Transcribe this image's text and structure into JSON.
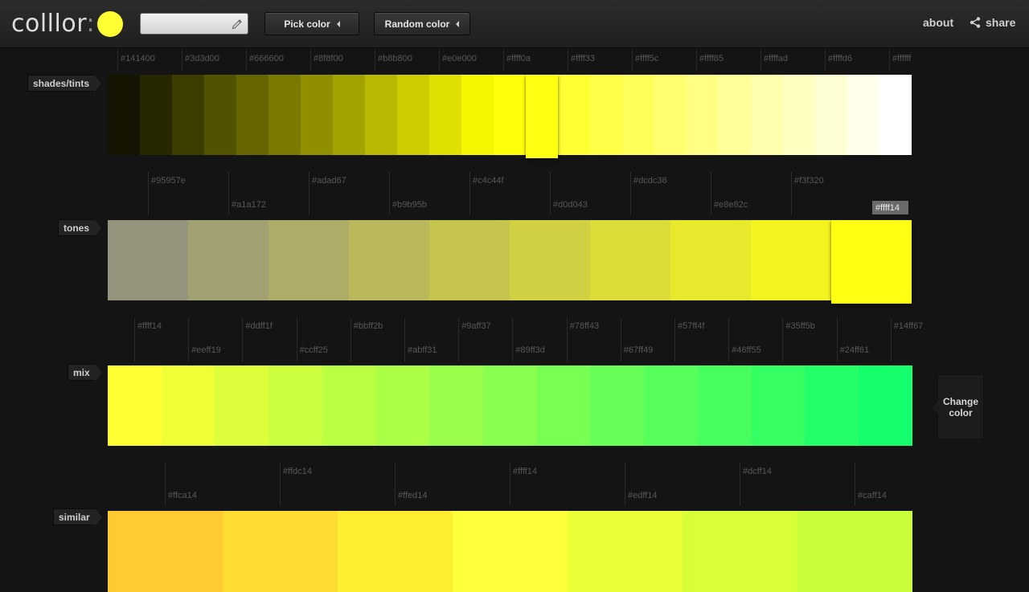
{
  "app": {
    "logo_text": "colllor",
    "logo_colon": ":",
    "logo_color": "#ffff33"
  },
  "toolbar": {
    "search_value": "",
    "pick_label": "Pick color",
    "random_label": "Random color",
    "about_label": "about",
    "share_label": "share"
  },
  "sections": {
    "shades": {
      "label": "shades/tints",
      "colors": [
        "#141400",
        "#282800",
        "#3d3d00",
        "#525200",
        "#666600",
        "#7a7a00",
        "#8f8f00",
        "#a3a300",
        "#b8b800",
        "#cccc00",
        "#e0e000",
        "#f5f500",
        "#ffff0a",
        "#ffff14",
        "#ffff33",
        "#ffff47",
        "#ffff5c",
        "#ffff70",
        "#ffff85",
        "#ffff99",
        "#ffffad",
        "#ffffc2",
        "#ffffd6",
        "#ffffeb",
        "#ffffff"
      ],
      "labels": [
        "#141400",
        "#3d3d00",
        "#666600",
        "#8f8f00",
        "#b8b800",
        "#e0e000",
        "#ffff0a",
        "#ffff33",
        "#ffff5c",
        "#ffff85",
        "#ffffad",
        "#ffffd6",
        "#ffffff"
      ],
      "selected_index": 13
    },
    "tones": {
      "label": "tones",
      "colors": [
        "#95957e",
        "#a1a172",
        "#adad67",
        "#b9b95b",
        "#c4c44f",
        "#d0d043",
        "#dcdc38",
        "#e8e82c",
        "#f3f320",
        "#ffff14"
      ],
      "labels": [
        "#95957e",
        "#a1a172",
        "#adad67",
        "#b9b95b",
        "#c4c44f",
        "#d0d043",
        "#dcdc38",
        "#e8e82c",
        "#f3f320"
      ],
      "selected_label": "#ffff14"
    },
    "mix": {
      "label": "mix",
      "colors": [
        "#ffff33",
        "#eeff37",
        "#ddff3b",
        "#ccff3f",
        "#bbff43",
        "#abff47",
        "#9aff4b",
        "#89ff4f",
        "#78ff53",
        "#67ff57",
        "#57ff5b",
        "#46ff5f",
        "#35ff63",
        "#24ff67",
        "#14ff6b"
      ],
      "labels": [
        "#ffff14",
        "#eeff19",
        "#ddff1f",
        "#ccff25",
        "#bbff2b",
        "#abff31",
        "#9aff37",
        "#89ff3d",
        "#78ff43",
        "#67ff49",
        "#57ff4f",
        "#46ff55",
        "#35ff5b",
        "#24ff61",
        "#14ff67"
      ]
    },
    "similar": {
      "label": "similar",
      "colors": [
        "#ffca32",
        "#ffdc32",
        "#ffed32",
        "#ffff3c",
        "#eaff37",
        "#d8ff37",
        "#c8ff38"
      ],
      "labels": [
        "#ffca14",
        "#ffdc14",
        "#ffed14",
        "#ffff14",
        "#edff14",
        "#dcff14",
        "#caff14"
      ]
    }
  },
  "change_button": {
    "line1": "Change",
    "line2": "color"
  }
}
